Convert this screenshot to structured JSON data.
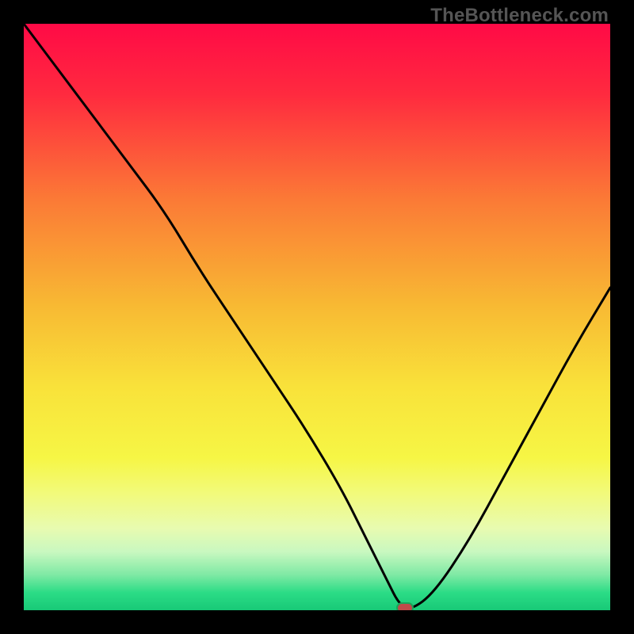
{
  "watermark": "TheBottleneck.com",
  "colors": {
    "black": "#000000",
    "marker_fill": "#c04a4a",
    "marker_stroke": "#1aa35a",
    "curve": "#000000"
  },
  "chart_data": {
    "type": "line",
    "title": "",
    "xlabel": "",
    "ylabel": "",
    "xlim": [
      0,
      100
    ],
    "ylim": [
      0,
      100
    ],
    "gradient_stops": [
      {
        "offset": 0,
        "color": "#ff0a46"
      },
      {
        "offset": 12,
        "color": "#ff2a3f"
      },
      {
        "offset": 30,
        "color": "#fb7a36"
      },
      {
        "offset": 48,
        "color": "#f8b933"
      },
      {
        "offset": 62,
        "color": "#f9e23a"
      },
      {
        "offset": 74,
        "color": "#f6f645"
      },
      {
        "offset": 80,
        "color": "#f2fa7a"
      },
      {
        "offset": 86,
        "color": "#e8fbb0"
      },
      {
        "offset": 90,
        "color": "#c9f8c0"
      },
      {
        "offset": 94,
        "color": "#7ee9a4"
      },
      {
        "offset": 97,
        "color": "#2bdc86"
      },
      {
        "offset": 100,
        "color": "#18c977"
      }
    ],
    "series": [
      {
        "name": "bottleneck-curve",
        "x": [
          0,
          6,
          12,
          18,
          24,
          30,
          36,
          42,
          48,
          54,
          58,
          62,
          64,
          66,
          70,
          76,
          82,
          88,
          94,
          100
        ],
        "y": [
          100,
          92,
          84,
          76,
          68,
          58,
          49,
          40,
          31,
          21,
          13,
          5,
          1,
          0,
          3,
          12,
          23,
          34,
          45,
          55
        ]
      }
    ],
    "marker": {
      "x": 65,
      "y": 0
    },
    "annotations": []
  }
}
